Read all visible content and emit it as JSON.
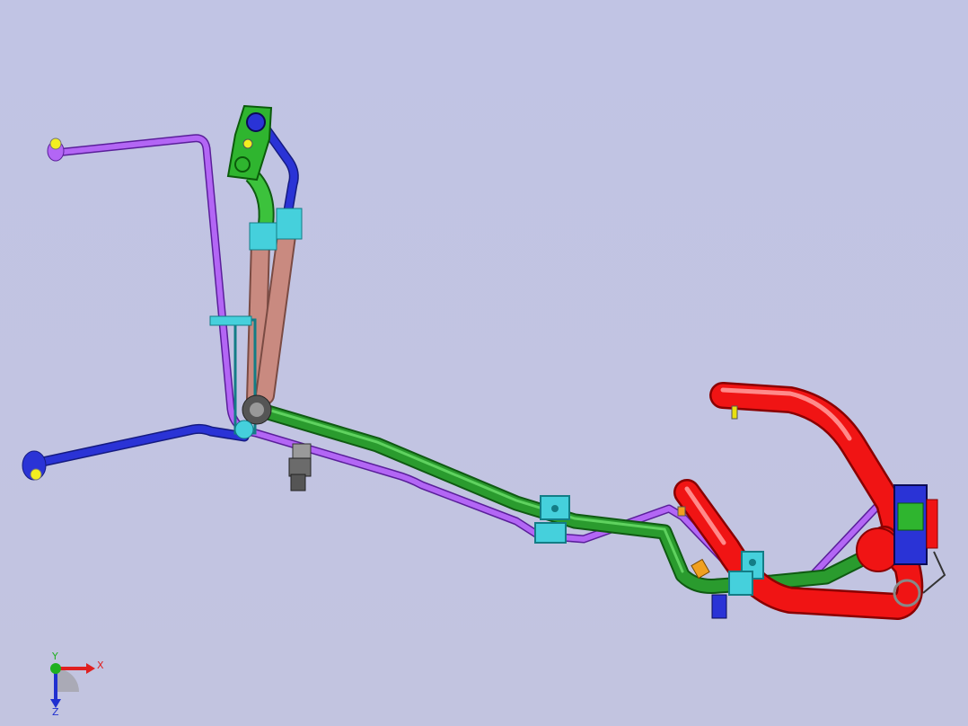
{
  "viewport": {
    "background_top": "#c1c4e4",
    "background_bottom": "#c2c4e0"
  },
  "triad": {
    "x_label": "X",
    "y_label": "Y",
    "z_label": "Z",
    "x_color": "#e02020",
    "y_color": "#20b020",
    "z_color": "#2030d0"
  },
  "colors": {
    "purple_line": "#a64ff0",
    "blue_line": "#2a33d6",
    "green_line": "#1c8f22",
    "red_hose": "#f01414",
    "copper_tube": "#c98a80",
    "cyan_clamp": "#45d0dc",
    "green_block": "#2fb52f",
    "yellow_fitting": "#e8e010",
    "sensor_grey": "#6b6b6b",
    "orange_cap": "#f0a020"
  }
}
